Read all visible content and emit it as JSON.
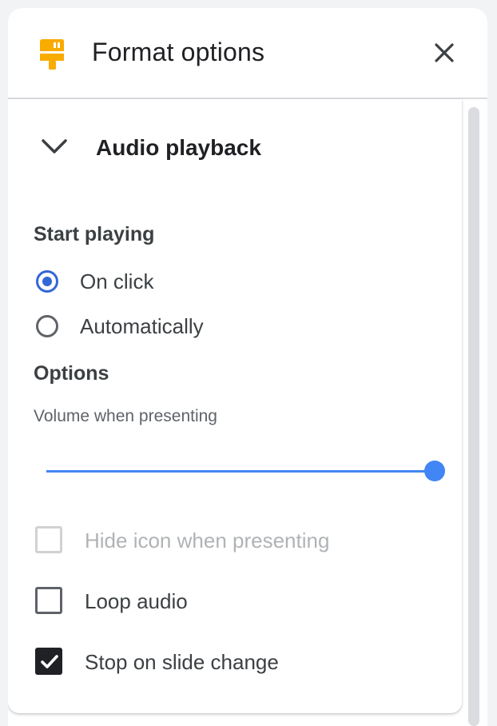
{
  "header": {
    "title": "Format options",
    "icon": "paint-roller-icon",
    "close_icon": "close-icon",
    "accent_color": "#f9ab00"
  },
  "section": {
    "title": "Audio playback",
    "expanded": true,
    "chevron_icon": "chevron-down-icon"
  },
  "start_playing": {
    "label": "Start playing",
    "options": [
      {
        "label": "On click",
        "checked": true
      },
      {
        "label": "Automatically",
        "checked": false
      }
    ]
  },
  "options": {
    "label": "Options",
    "volume_label": "Volume when presenting",
    "volume_value": 1.0,
    "checkboxes": [
      {
        "label": "Hide icon when presenting",
        "checked": false,
        "disabled": true
      },
      {
        "label": "Loop audio",
        "checked": false,
        "disabled": false
      },
      {
        "label": "Stop on slide change",
        "checked": true,
        "disabled": false
      }
    ]
  },
  "colors": {
    "accent_blue": "#4285f4",
    "radio_blue": "#3367d6"
  }
}
